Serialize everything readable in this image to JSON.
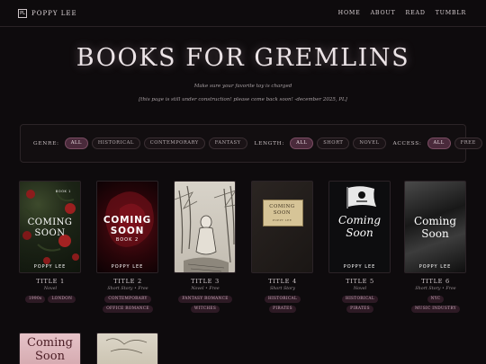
{
  "nav": {
    "logo_mark": "PL",
    "brand": "POPPY LEE",
    "links": [
      "HOME",
      "ABOUT",
      "READ",
      "TUMBLR"
    ]
  },
  "hero": {
    "title": "BOOKS FOR GREMLINS",
    "tagline": "Make sure your favorite toy is charged",
    "notice": "[this page is still under construction! please come back soon! -december 2025, PL]"
  },
  "filters": {
    "genre_label": "GENRE:",
    "genre": [
      "ALL",
      "HISTORICAL",
      "CONTEMPORARY",
      "FANTASY"
    ],
    "length_label": "LENGTH:",
    "length": [
      "ALL",
      "SHORT",
      "NOVEL"
    ],
    "access_label": "ACCESS:",
    "access": [
      "ALL",
      "FREE"
    ],
    "active": "ALL"
  },
  "books": [
    {
      "title": "TITLE 1",
      "meta": "Novel",
      "tags": [
        "1990s",
        "LONDON"
      ],
      "cover": {
        "line1": "COMING",
        "line2": "SOON",
        "top": "BOOK 1",
        "author": "POPPY LEE"
      }
    },
    {
      "title": "TITLE 2",
      "meta": "Short Story • Free",
      "tags": [
        "CONTEMPORARY",
        "OFFICE ROMANCE"
      ],
      "cover": {
        "line1": "COMING",
        "line2": "SOON",
        "sub": "BOOK 2",
        "author": "POPPY LEE"
      }
    },
    {
      "title": "TITLE 3",
      "meta": "Novel • Free",
      "tags": [
        "FANTASY ROMANCE",
        "WITCHES"
      ],
      "cover": {}
    },
    {
      "title": "TITLE 4",
      "meta": "Short Story",
      "tags": [
        "HISTORICAL",
        "PIRATES"
      ],
      "cover": {
        "line1": "COMING",
        "line2": "SOON",
        "author": "POPPY LEE"
      }
    },
    {
      "title": "TITLE 5",
      "meta": "Novel",
      "tags": [
        "HISTORICAL",
        "PIRATES"
      ],
      "cover": {
        "line1": "Coming",
        "line2": "Soon",
        "author": "POPPY LEE"
      }
    },
    {
      "title": "TITLE 6",
      "meta": "Short Story • Free",
      "tags": [
        "NYC",
        "MUSIC INDUSTRY"
      ],
      "cover": {
        "line1": "Coming",
        "line2": "Soon",
        "author": "POPPY LEE"
      }
    },
    {
      "title": "",
      "meta": "",
      "tags": [],
      "cover": {
        "line1": "Coming",
        "line2": "Soon"
      }
    },
    {
      "title": "",
      "meta": "",
      "tags": [],
      "cover": {}
    }
  ]
}
